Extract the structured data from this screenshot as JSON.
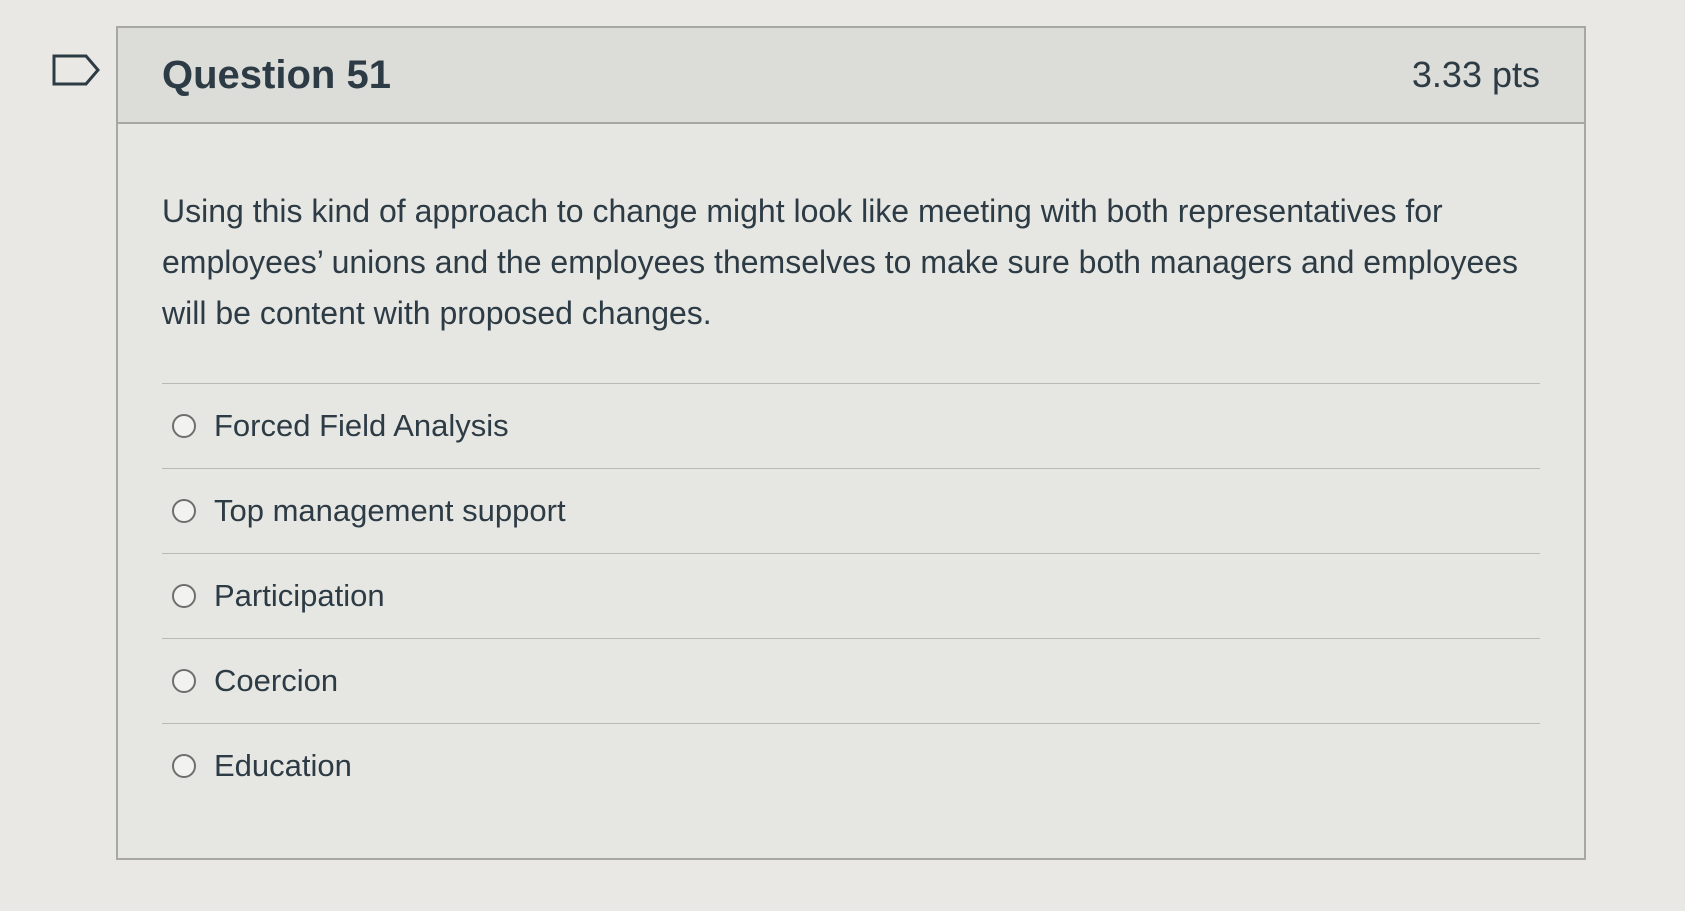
{
  "question": {
    "title": "Question 51",
    "points": "3.33 pts",
    "text": "Using this kind of approach to change might look like meeting with both representatives for employees’ unions and the employees themselves to make sure both managers and employees will be content with proposed changes."
  },
  "answers": [
    {
      "label": "Forced Field Analysis"
    },
    {
      "label": "Top management support"
    },
    {
      "label": "Participation"
    },
    {
      "label": "Coercion"
    },
    {
      "label": "Education"
    }
  ],
  "colors": {
    "background": "#e9e8e4",
    "header": "#dcdcd9",
    "text": "#2d3b45",
    "border": "#a7a7a4"
  },
  "icons": {
    "flag": "flag-outline-icon",
    "radio": "radio-unchecked-icon"
  }
}
